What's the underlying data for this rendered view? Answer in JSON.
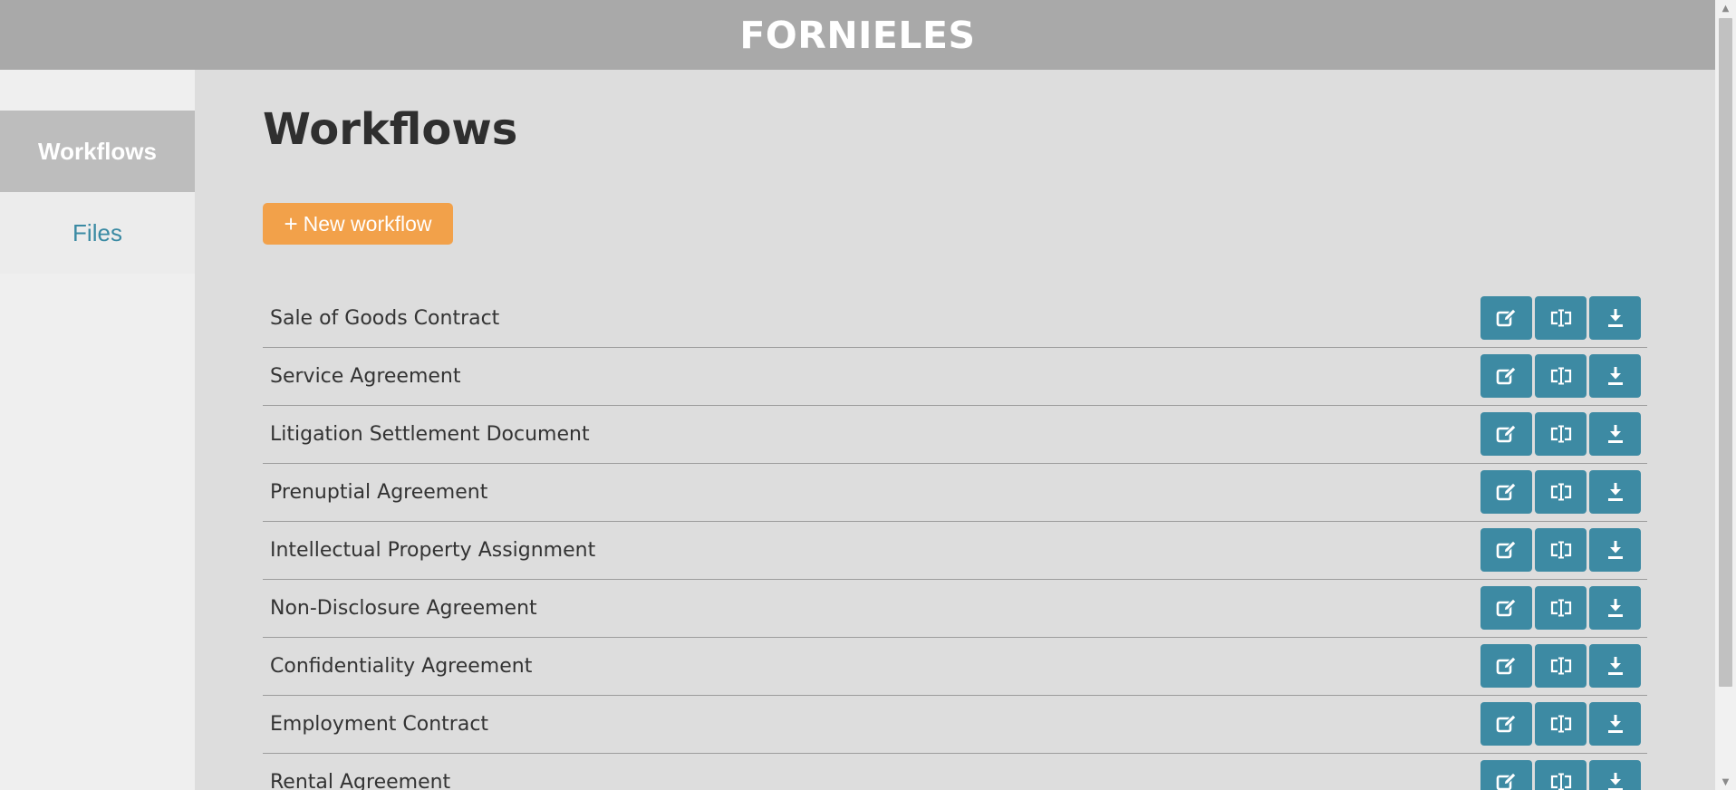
{
  "header": {
    "brand": "FORNIELES"
  },
  "sidebar": {
    "items": [
      {
        "label": "Workflows",
        "active": true
      },
      {
        "label": "Files",
        "active": false
      }
    ]
  },
  "main": {
    "title": "Workflows",
    "new_button": {
      "icon": "plus-icon",
      "label": "New workflow"
    },
    "workflows": [
      {
        "title": "Sale of Goods Contract"
      },
      {
        "title": "Service Agreement"
      },
      {
        "title": "Litigation Settlement Document"
      },
      {
        "title": "Prenuptial Agreement"
      },
      {
        "title": "Intellectual Property Assignment"
      },
      {
        "title": "Non-Disclosure Agreement"
      },
      {
        "title": "Confidentiality Agreement"
      },
      {
        "title": "Employment Contract"
      },
      {
        "title": "Rental Agreement"
      }
    ],
    "row_actions": [
      "edit-icon",
      "rename-icon",
      "download-icon"
    ]
  },
  "colors": {
    "header_bg": "#a9a9a9",
    "accent_orange": "#f2a14a",
    "action_teal": "#3d8aa3",
    "link_teal": "#3a8aa3"
  }
}
